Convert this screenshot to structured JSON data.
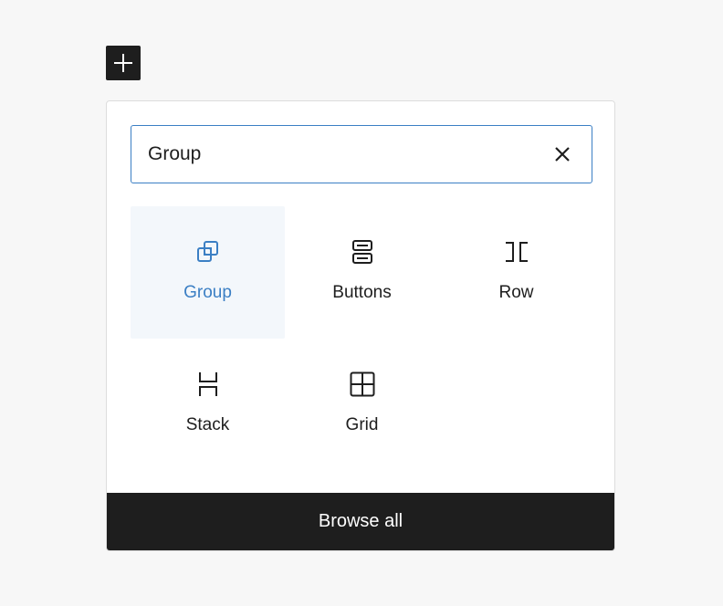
{
  "toolbar": {
    "add_icon": "plus-icon"
  },
  "search": {
    "value": "Group",
    "clear_icon": "close-icon"
  },
  "blocks": [
    {
      "label": "Group",
      "icon": "group-icon",
      "selected": true
    },
    {
      "label": "Buttons",
      "icon": "buttons-icon",
      "selected": false
    },
    {
      "label": "Row",
      "icon": "row-icon",
      "selected": false
    },
    {
      "label": "Stack",
      "icon": "stack-icon",
      "selected": false
    },
    {
      "label": "Grid",
      "icon": "grid-icon",
      "selected": false
    }
  ],
  "footer": {
    "browse_all_label": "Browse all"
  },
  "colors": {
    "accent": "#3b7fc4",
    "dark": "#1e1e1e",
    "selected_bg": "#f3f7fb"
  }
}
